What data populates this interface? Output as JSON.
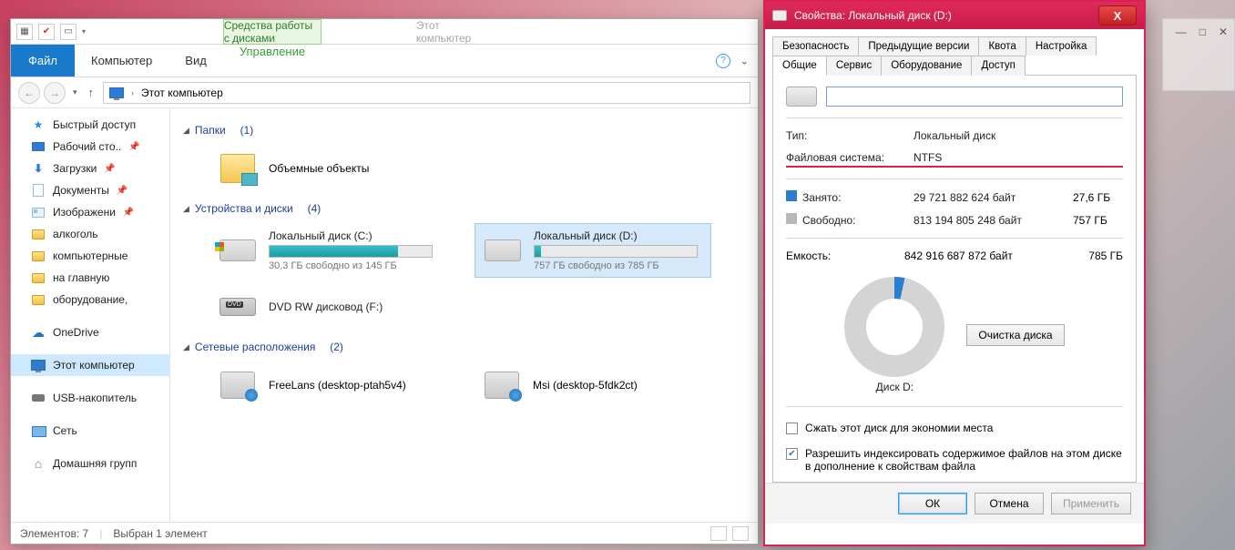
{
  "explorer": {
    "context_group": "Средства работы с дисками",
    "inactive_title": "Этот компьютер",
    "tabs": {
      "file": "Файл",
      "computer": "Компьютер",
      "view": "Вид",
      "manage": "Управление"
    },
    "address": "Этот компьютер",
    "sidebar": {
      "quick_access": "Быстрый доступ",
      "desktop": "Рабочий сто..",
      "downloads": "Загрузки",
      "documents": "Документы",
      "pictures": "Изображени",
      "f_alcohol": "алкоголь",
      "f_computer": "компьютерные",
      "f_home": "на главную",
      "f_equipment": "оборудование,",
      "onedrive": "OneDrive",
      "this_pc": "Этот компьютер",
      "usb": "USB-накопитель",
      "network": "Сеть",
      "homegroup": "Домашняя групп"
    },
    "sections": {
      "folders": {
        "title": "Папки",
        "count": "(1)",
        "item": "Объемные объекты"
      },
      "devices": {
        "title": "Устройства и диски",
        "count": "(4)",
        "c": {
          "title": "Локальный диск (C:)",
          "sub": "30,3 ГБ свободно из 145 ГБ",
          "fill": 79
        },
        "d": {
          "title": "Локальный диск (D:)",
          "sub": "757 ГБ свободно из 785 ГБ",
          "fill": 4
        },
        "dvd": {
          "title": "DVD RW дисковод (F:)"
        }
      },
      "network": {
        "title": "Сетевые расположения",
        "count": "(2)",
        "a": "FreeLans (desktop-ptah5v4)",
        "b": "Msi (desktop-5fdk2ct)"
      }
    },
    "status": {
      "elements": "Элементов: 7",
      "selected": "Выбран 1 элемент"
    }
  },
  "props": {
    "title": "Свойства: Локальный диск (D:)",
    "tabs_top": {
      "security": "Безопасность",
      "prev": "Предыдущие версии",
      "quota": "Квота",
      "custom": "Настройка"
    },
    "tabs_bot": {
      "general": "Общие",
      "service": "Сервис",
      "hardware": "Оборудование",
      "sharing": "Доступ"
    },
    "type_lbl": "Тип:",
    "type_val": "Локальный диск",
    "fs_lbl": "Файловая система:",
    "fs_val": "NTFS",
    "used_lbl": "Занято:",
    "used_bytes": "29 721 882 624 байт",
    "used_gb": "27,6 ГБ",
    "free_lbl": "Свободно:",
    "free_bytes": "813 194 805 248 байт",
    "free_gb": "757 ГБ",
    "cap_lbl": "Емкость:",
    "cap_bytes": "842 916 687 872 байт",
    "cap_gb": "785 ГБ",
    "disk_label": "Диск D:",
    "cleanup": "Очистка диска",
    "chk1": "Сжать этот диск для экономии места",
    "chk2": "Разрешить индексировать содержимое файлов на этом диске в дополнение к свойствам файла",
    "ok": "ОК",
    "cancel": "Отмена",
    "apply": "Применить"
  }
}
